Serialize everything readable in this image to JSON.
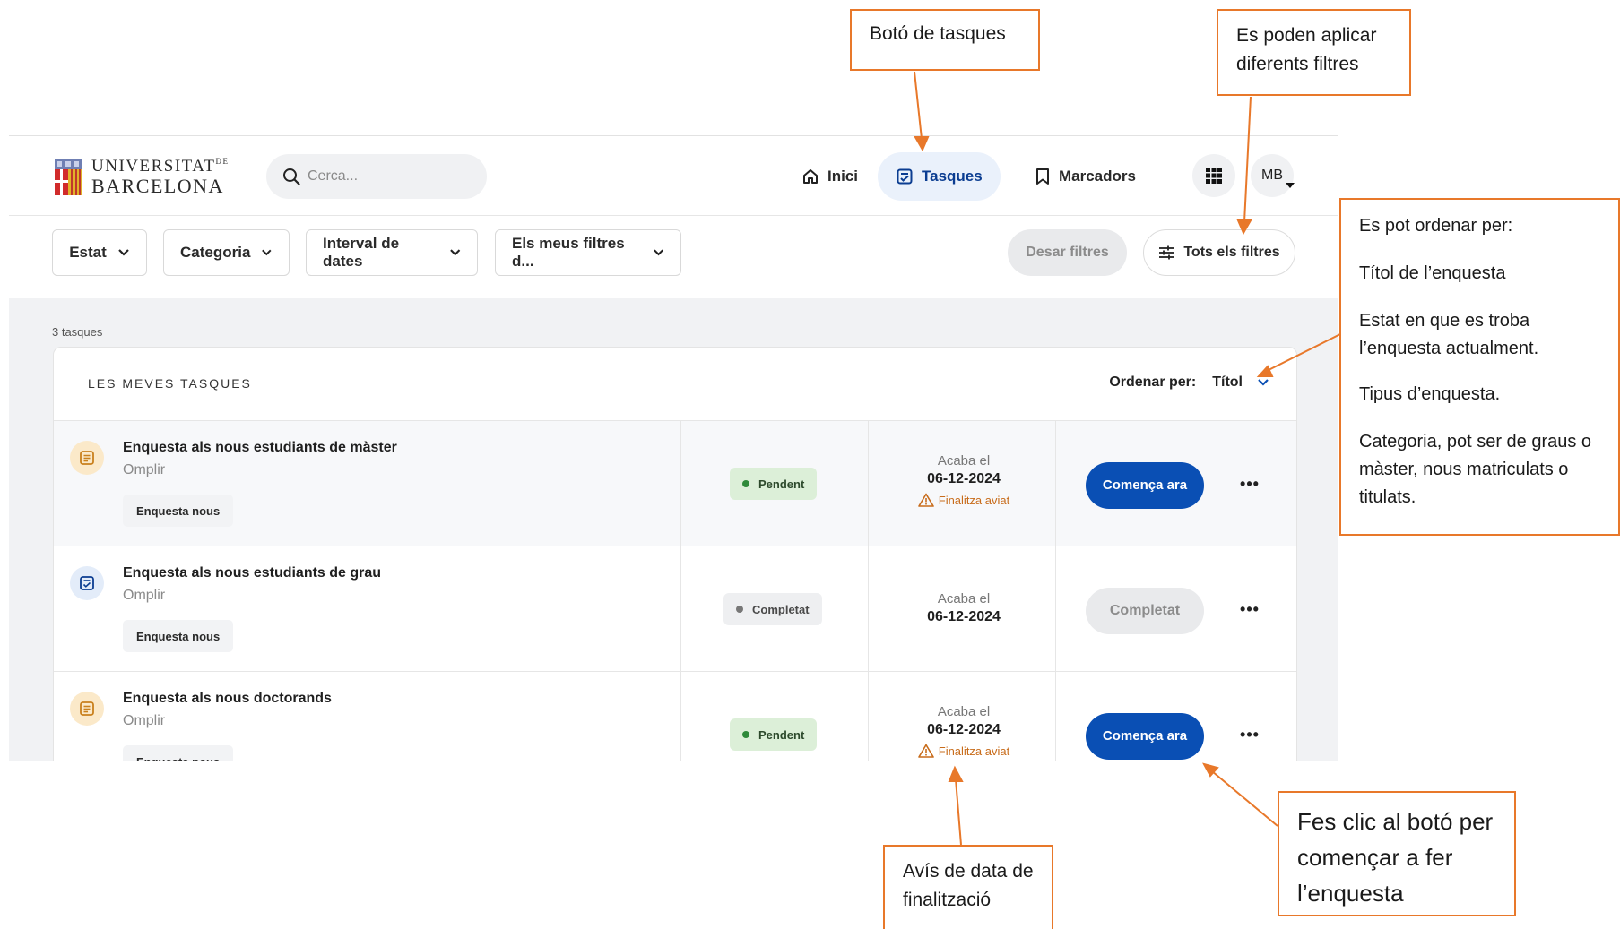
{
  "annotations": {
    "tasks_button": "Botó de tasques",
    "filters": "Es poden aplicar diferents filtres",
    "sort_lines": [
      "Es pot ordenar per:",
      "Títol de l’enquesta",
      "Estat en que es troba l’enquesta actualment.",
      "Tipus d’enquesta.",
      "Categoria, pot ser de graus o màster, nous matriculats o titulats."
    ],
    "deadline": "Avís de data de finalització",
    "start": "Fes clic al botó per començar a fer l’enquesta"
  },
  "header": {
    "logo_line1": "UNIVERSITAT",
    "logo_de": "DE",
    "logo_line2": "BARCELONA",
    "search_placeholder": "Cerca...",
    "nav": {
      "home": "Inici",
      "tasks": "Tasques",
      "bookmarks": "Marcadors"
    },
    "avatar": "MB"
  },
  "filters": {
    "estat": "Estat",
    "categoria": "Categoria",
    "interval": "Interval de dates",
    "meus": "Els meus filtres d...",
    "save": "Desar filtres",
    "all": "Tots els filtres"
  },
  "list": {
    "count": "3 tasques",
    "title": "LES MEVES TASQUES",
    "sort_label": "Ordenar per:",
    "sort_value": "Títol",
    "rows": [
      {
        "title": "Enquesta als nous estudiants de màster",
        "sub": "Omplir",
        "tag": "Enquesta nous",
        "status": "Pendent",
        "date_label": "Acaba el",
        "date": "06-12-2024",
        "warn": "Finalitza aviat",
        "cta": "Comença ara"
      },
      {
        "title": "Enquesta als nous estudiants de grau",
        "sub": "Omplir",
        "tag": "Enquesta nous",
        "status": "Completat",
        "date_label": "Acaba el",
        "date": "06-12-2024",
        "cta": "Completat"
      },
      {
        "title": "Enquesta als nous doctorands",
        "sub": "Omplir",
        "tag": "Enquesta nous",
        "status": "Pendent",
        "date_label": "Acaba el",
        "date": "06-12-2024",
        "warn": "Finalitza aviat",
        "cta": "Comença ara"
      }
    ]
  },
  "colors": {
    "accent": "#0a4fb4",
    "annotation": "#e8782a",
    "pending_bg": "#dcefd8",
    "warning": "#c86c1b"
  }
}
